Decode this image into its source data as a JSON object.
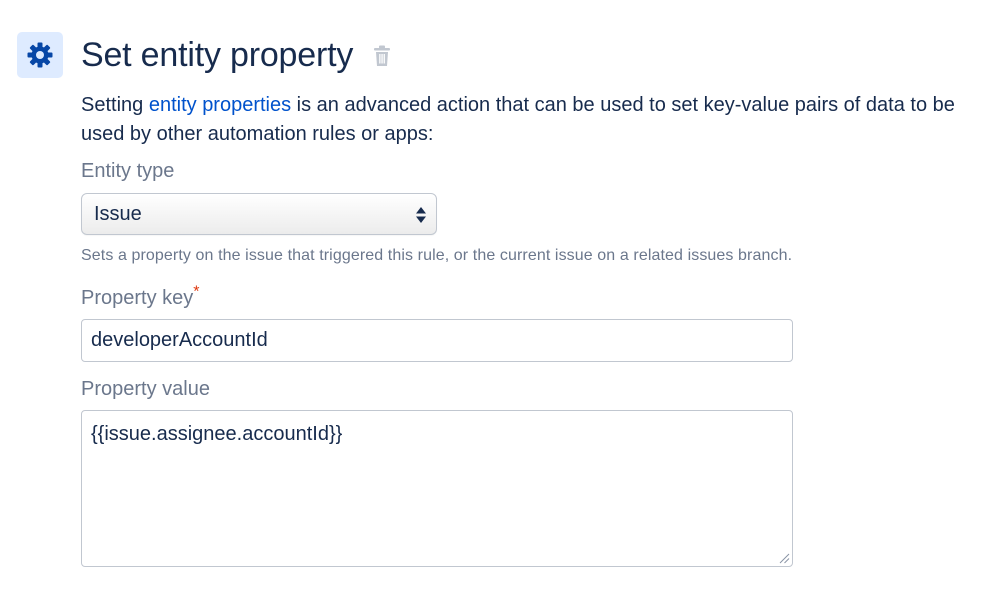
{
  "header": {
    "title": "Set entity property",
    "icon": "gear-icon",
    "delete_icon": "trash-icon"
  },
  "description": {
    "prefix": "Setting ",
    "link": "entity properties",
    "suffix": " is an advanced action that can be used to set key-value pairs of data to be used by other automation rules or apps:"
  },
  "entity_type": {
    "label": "Entity type",
    "selected": "Issue",
    "hint": "Sets a property on the issue that triggered this rule, or the current issue on a related issues branch."
  },
  "property_key": {
    "label": "Property key",
    "required_mark": "*",
    "value": "developerAccountId"
  },
  "property_value": {
    "label": "Property value",
    "value": "{{issue.assignee.accountId}}"
  },
  "colors": {
    "accent": "#0052cc",
    "icon_tile": "#deebff",
    "title_text": "#172b4d",
    "muted_text": "#6b778c",
    "required": "#de350b"
  }
}
